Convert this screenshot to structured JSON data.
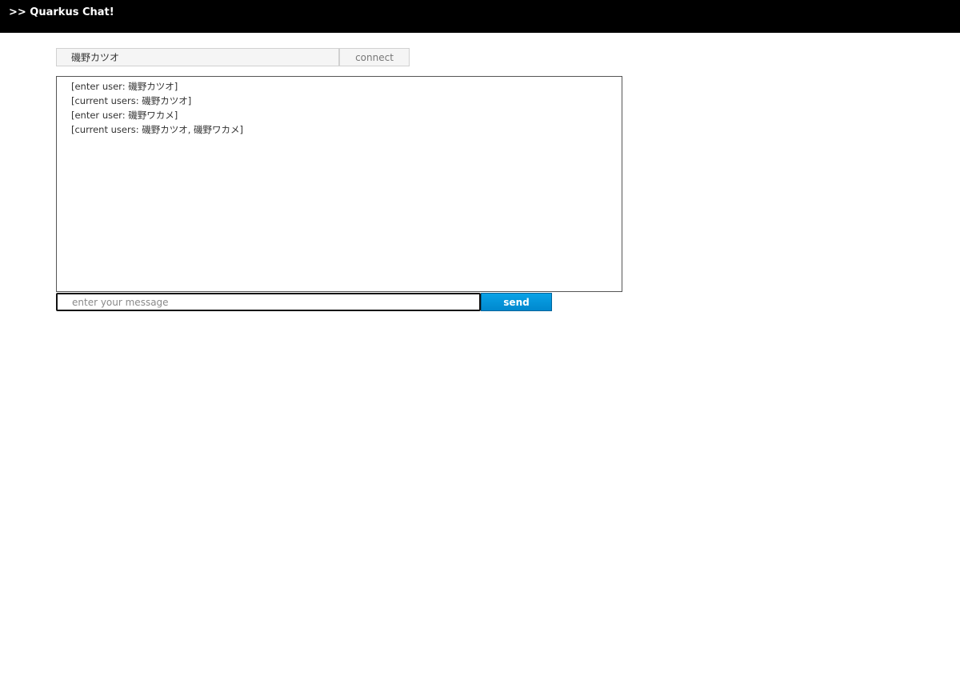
{
  "app": {
    "title": ">> Quarkus Chat!"
  },
  "connect_form": {
    "name_value": "磯野カツオ",
    "connect_label": "connect"
  },
  "chat": {
    "lines": [
      "[enter user: 磯野カツオ]",
      "[current users: 磯野カツオ]",
      "[enter user: 磯野ワカメ]",
      "[current users: 磯野カツオ, 磯野ワカメ]"
    ]
  },
  "message_form": {
    "placeholder": "enter your message",
    "send_label": "send"
  },
  "colors": {
    "topbar_bg": "#000000",
    "send_button_bg": "#0088ce"
  }
}
